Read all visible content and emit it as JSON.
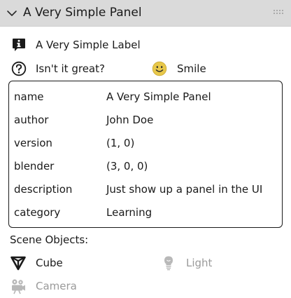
{
  "panel": {
    "title": "A Very Simple Panel"
  },
  "label_row": {
    "text": "A Very Simple Label",
    "icon": "info-icon"
  },
  "question_row": {
    "text": "Isn't it great?",
    "icon": "question-icon",
    "smile_text": "Smile",
    "smile_icon": "smile-icon"
  },
  "info": [
    {
      "key": "name",
      "value": "A Very Simple Panel"
    },
    {
      "key": "author",
      "value": "John Doe"
    },
    {
      "key": "version",
      "value": "(1, 0)"
    },
    {
      "key": "blender",
      "value": "(3, 0, 0)"
    },
    {
      "key": "description",
      "value": "Just show up a panel in the UI"
    },
    {
      "key": "category",
      "value": "Learning"
    }
  ],
  "scene": {
    "label": "Scene Objects:",
    "objects": [
      {
        "name": "Cube",
        "icon": "mesh-cone-icon",
        "enabled": true
      },
      {
        "name": "Light",
        "icon": "light-bulb-icon",
        "enabled": false
      },
      {
        "name": "Camera",
        "icon": "camera-icon",
        "enabled": false
      }
    ]
  },
  "colors": {
    "header_bg": "#dadada",
    "text": "#1a1a1a",
    "disabled_text": "#9a9a9a",
    "smile_face": "#e8c84a"
  }
}
